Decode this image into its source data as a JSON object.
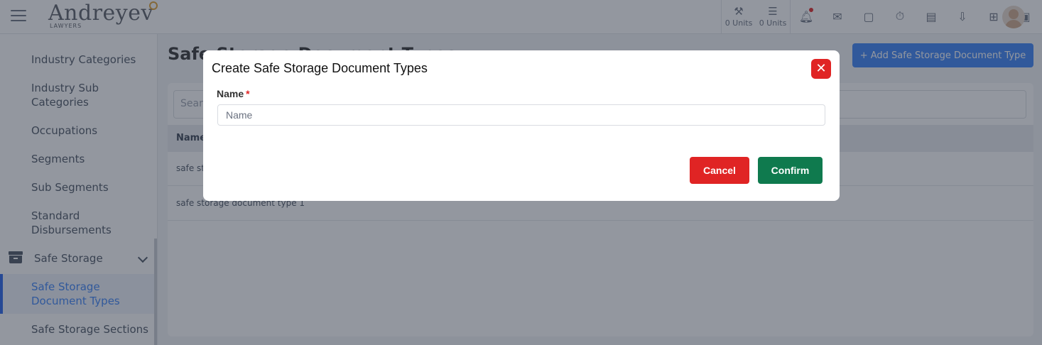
{
  "header": {
    "logo_text": "Andreyev",
    "logo_sub": "LAWYERS",
    "units": [
      {
        "icon": "gavel-icon",
        "label": "0 Units"
      },
      {
        "icon": "list-icon",
        "label": "0 Units"
      }
    ],
    "toolbar_icons": [
      "bell-icon",
      "inbox-icon",
      "note-icon",
      "stopwatch-icon",
      "file-question-icon",
      "file-upload-icon",
      "plus-square-icon",
      "id-badge-icon"
    ]
  },
  "sidebar": {
    "items": [
      {
        "label": "Industry Categories"
      },
      {
        "label": "Industry Sub Categories"
      },
      {
        "label": "Occupations"
      },
      {
        "label": "Segments"
      },
      {
        "label": "Sub Segments"
      },
      {
        "label": "Standard Disbursements"
      },
      {
        "label": "Safe Storage"
      },
      {
        "label": "Safe Storage Document Types"
      },
      {
        "label": "Safe Storage Sections"
      }
    ]
  },
  "main": {
    "title": "Safe Storage Document Types",
    "add_button": "+ Add Safe Storage Document Type",
    "search_placeholder": "Search",
    "table": {
      "header": "Name",
      "rows": [
        "safe storage document type 2",
        "safe storage document type 1"
      ]
    }
  },
  "modal": {
    "title": "Create Safe Storage Document Types",
    "close_glyph": "✕",
    "field_label": "Name",
    "required_mark": "*",
    "field_placeholder": "Name",
    "field_value": "",
    "cancel_label": "Cancel",
    "confirm_label": "Confirm"
  },
  "colors": {
    "danger": "#e02424",
    "success": "#0f7a4e",
    "primary": "#3b82f6"
  }
}
